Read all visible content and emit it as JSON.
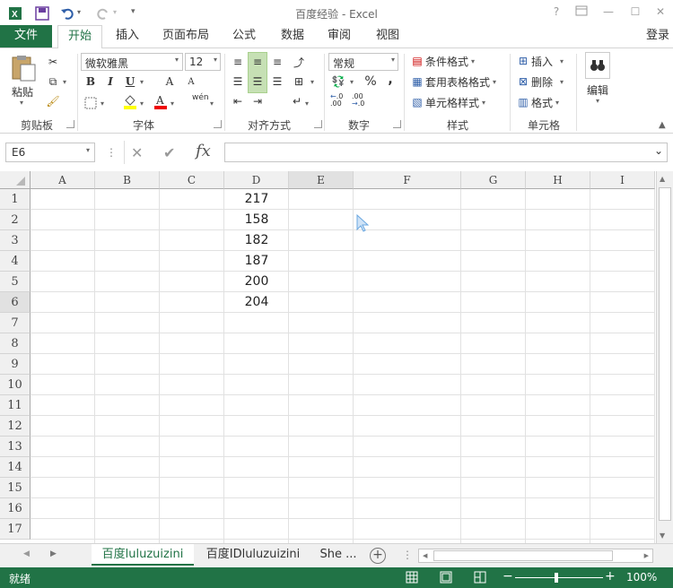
{
  "window": {
    "title": "百度经验 - Excel",
    "help": "?",
    "sign_in": "登录"
  },
  "quick_access": {
    "app_icon": "excel-icon",
    "save_icon": "save-icon",
    "undo_icon": "undo-icon",
    "redo_icon": "redo-icon",
    "customize_icon": "customize-icon"
  },
  "tabs": [
    {
      "label": "文件"
    },
    {
      "label": "开始"
    },
    {
      "label": "插入"
    },
    {
      "label": "页面布局"
    },
    {
      "label": "公式"
    },
    {
      "label": "数据"
    },
    {
      "label": "审阅"
    },
    {
      "label": "视图"
    }
  ],
  "ribbon": {
    "clipboard": {
      "paste": "粘贴",
      "label": "剪贴板"
    },
    "font": {
      "name": "微软雅黑",
      "size": "12",
      "bold": "B",
      "italic": "I",
      "underline": "U",
      "grow": "A",
      "shrink": "A",
      "phonetic": "wén",
      "label": "字体"
    },
    "alignment": {
      "label": "对齐方式"
    },
    "number": {
      "format": "常规",
      "percent": "%",
      "comma": ",",
      "inc_decimal": ".00",
      "dec_decimal": ".00",
      "label": "数字"
    },
    "styles": {
      "conditional": "条件格式",
      "table": "套用表格格式",
      "cell": "单元格样式",
      "label": "样式"
    },
    "cells": {
      "insert": "插入",
      "delete": "删除",
      "format": "格式",
      "label": "单元格"
    },
    "editing": {
      "label": "编辑"
    }
  },
  "formula_bar": {
    "name_box": "E6",
    "fx": "fx",
    "value": ""
  },
  "sheet": {
    "columns": [
      "A",
      "B",
      "C",
      "D",
      "E",
      "F",
      "G",
      "H",
      "I"
    ],
    "rows": [
      "1",
      "2",
      "3",
      "4",
      "5",
      "6",
      "7",
      "8",
      "9",
      "10",
      "11",
      "12",
      "13",
      "14",
      "15",
      "16",
      "17"
    ],
    "column_d_values": [
      "217",
      "158",
      "182",
      "187",
      "200",
      "204"
    ]
  },
  "sheet_tabs": [
    {
      "label": "百度luluzuizini"
    },
    {
      "label": "百度IDluluzuizini"
    },
    {
      "label": "She ..."
    }
  ],
  "status": {
    "mode": "就绪",
    "zoom": "100%",
    "zoom_minus": "−",
    "zoom_plus": "+"
  },
  "colors": {
    "excel_green": "#217346",
    "grid_line": "#e1e1e1",
    "header_bg": "#f0f0f0"
  }
}
